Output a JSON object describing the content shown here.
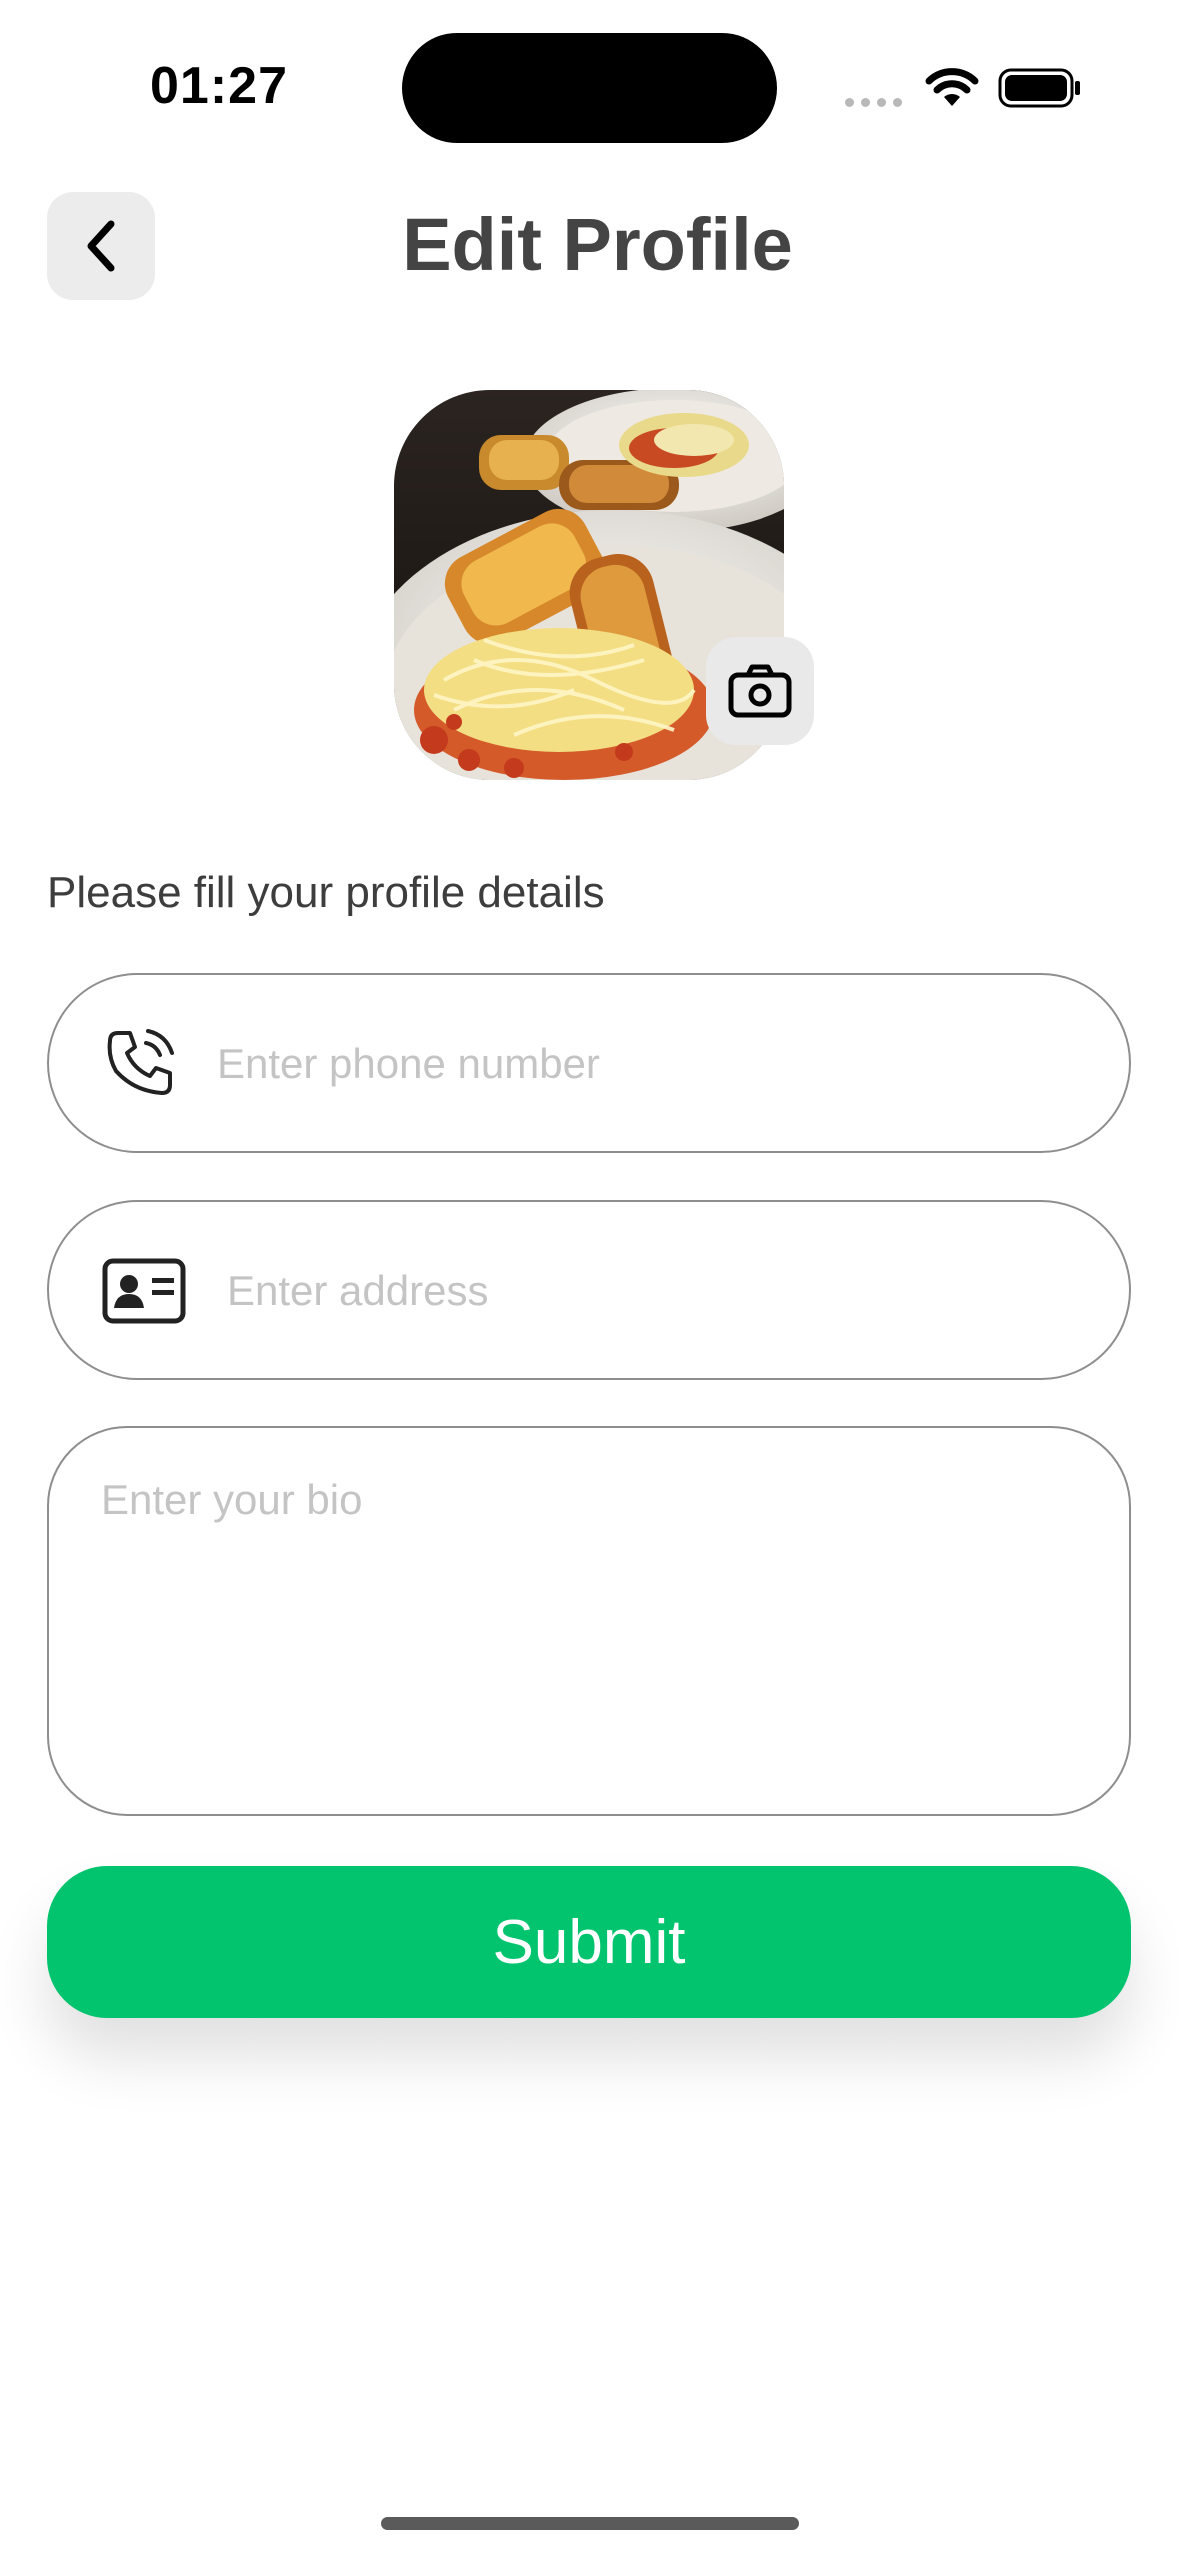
{
  "status_bar": {
    "time": "01:27"
  },
  "header": {
    "title": "Edit Profile",
    "back_icon": "chevron-left-icon"
  },
  "avatar": {
    "alt": "Profile photo",
    "edit_icon": "camera-icon"
  },
  "form": {
    "subtitle": "Please fill your profile details",
    "phone_placeholder": "Enter phone number",
    "address_placeholder": "Enter address",
    "bio_placeholder": "Enter your bio",
    "submit_label": "Submit"
  },
  "colors": {
    "accent": "#03c46e",
    "back_button_bg": "#ececec",
    "field_border": "#8e8e8e"
  }
}
